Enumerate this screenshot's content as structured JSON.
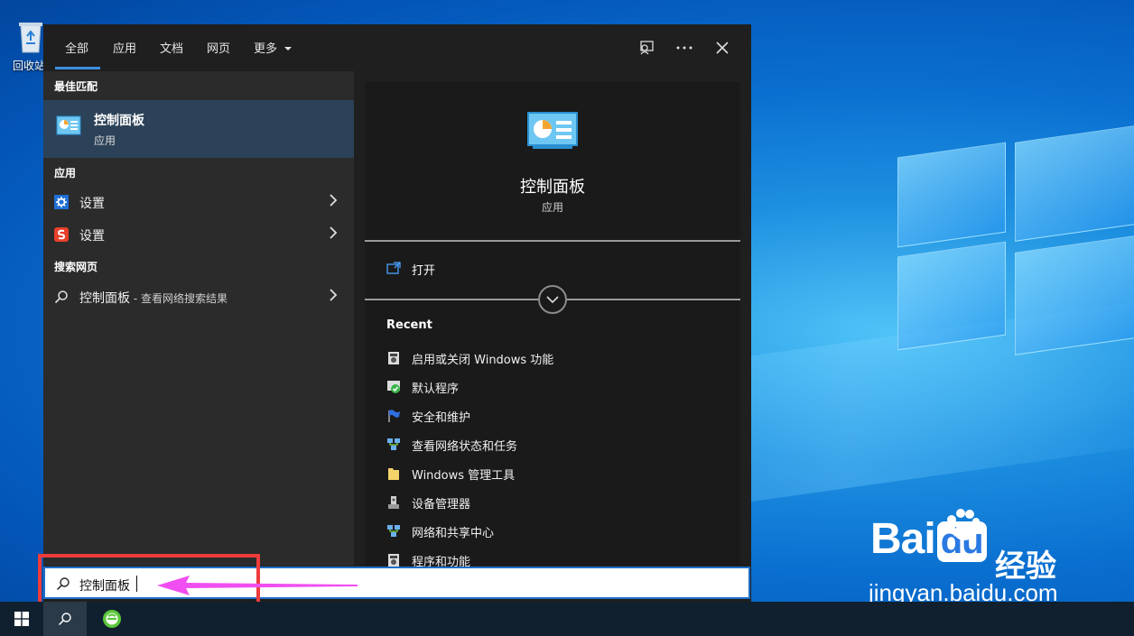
{
  "desktop": {
    "recycle_bin_label": "回收站",
    "watermark": {
      "logo_left": "Bai",
      "logo_right": "du",
      "logo_suffix": "经验",
      "url": "jingyan.baidu.com"
    }
  },
  "search": {
    "tabs": [
      {
        "label": "全部",
        "active": true
      },
      {
        "label": "应用"
      },
      {
        "label": "文档"
      },
      {
        "label": "网页"
      },
      {
        "label": "更多"
      }
    ],
    "best_match_header": "最佳匹配",
    "best_match": {
      "title": "控制面板",
      "subtitle": "应用"
    },
    "apps_header": "应用",
    "apps": [
      {
        "label": "设置",
        "icon": "gear-icon"
      },
      {
        "label": "设置",
        "icon": "sogou-settings-icon"
      }
    ],
    "web_header": "搜索网页",
    "web_result": {
      "label": "控制面板",
      "suffix": " - 查看网络搜索结果"
    },
    "detail": {
      "title": "控制面板",
      "subtitle": "应用",
      "open_label": "打开",
      "recent_header": "Recent",
      "recent_items": [
        {
          "label": "启用或关闭 Windows 功能",
          "icon": "windows-features-icon"
        },
        {
          "label": "默认程序",
          "icon": "default-programs-icon"
        },
        {
          "label": "安全和维护",
          "icon": "security-flag-icon"
        },
        {
          "label": "查看网络状态和任务",
          "icon": "network-icon"
        },
        {
          "label": "Windows 管理工具",
          "icon": "folder-icon"
        },
        {
          "label": "设备管理器",
          "icon": "device-manager-icon"
        },
        {
          "label": "网络和共享中心",
          "icon": "network-icon"
        },
        {
          "label": "程序和功能",
          "icon": "programs-icon"
        }
      ]
    },
    "query": "控制面板"
  },
  "colors": {
    "accent": "#3b8ee0",
    "highlight": "#ee3b3b",
    "arrow": "#f04ef0",
    "selected": "#2c4258"
  }
}
